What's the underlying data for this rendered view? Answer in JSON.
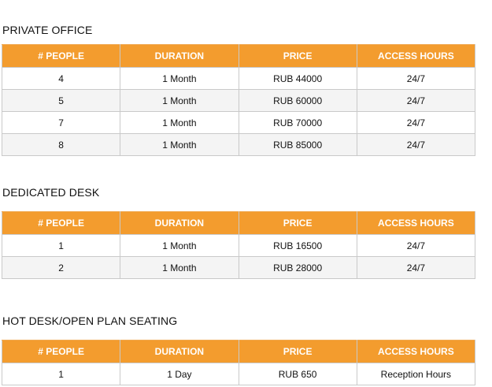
{
  "sections": [
    {
      "title": "PRIVATE OFFICE",
      "headers": [
        "# PEOPLE",
        "DURATION",
        "PRICE",
        "ACCESS HOURS"
      ],
      "rows": [
        [
          "4",
          "1 Month",
          "RUB 44000",
          "24/7"
        ],
        [
          "5",
          "1 Month",
          "RUB 60000",
          "24/7"
        ],
        [
          "7",
          "1 Month",
          "RUB 70000",
          "24/7"
        ],
        [
          "8",
          "1 Month",
          "RUB 85000",
          "24/7"
        ]
      ]
    },
    {
      "title": "DEDICATED DESK",
      "headers": [
        "# PEOPLE",
        "DURATION",
        "PRICE",
        "ACCESS HOURS"
      ],
      "rows": [
        [
          "1",
          "1 Month",
          "RUB 16500",
          "24/7"
        ],
        [
          "2",
          "1 Month",
          "RUB 28000",
          "24/7"
        ]
      ]
    },
    {
      "title": "HOT DESK/OPEN PLAN SEATING",
      "headers": [
        "# PEOPLE",
        "DURATION",
        "PRICE",
        "ACCESS HOURS"
      ],
      "rows": [
        [
          "1",
          "1 Day",
          "RUB 650",
          "Reception Hours"
        ]
      ]
    }
  ],
  "colors": {
    "header_bg": "#f39c2e",
    "header_text": "#ffffff",
    "alt_row_bg": "#f4f4f4",
    "border": "#c9c9c9"
  }
}
